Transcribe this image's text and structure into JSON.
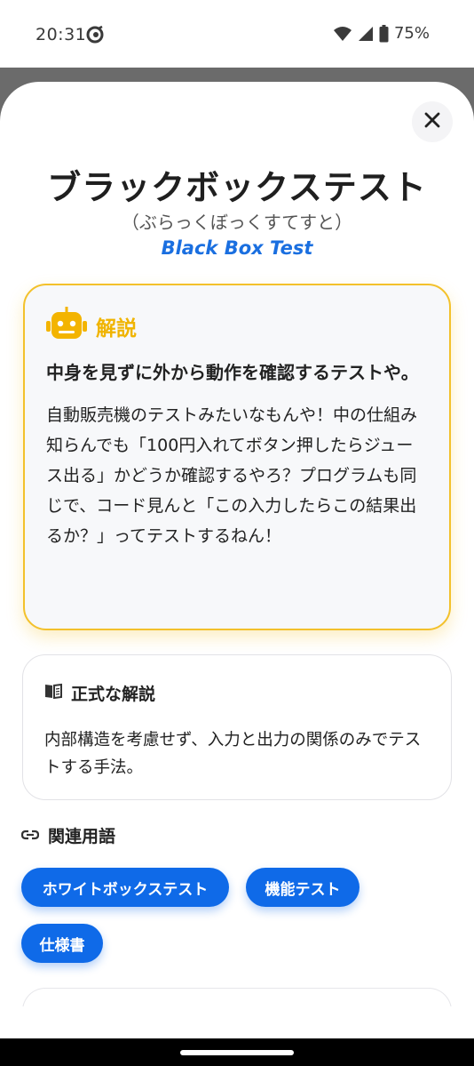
{
  "status_bar": {
    "time": "20:31",
    "battery": "75%",
    "icons": [
      "app-icon",
      "wifi-icon",
      "signal-icon",
      "battery-icon"
    ]
  },
  "sheet": {
    "close_icon": "close-icon",
    "title": "ブラックボックステスト",
    "reading": "（ぶらっくぼっくすてすと）",
    "english": "Black Box Test"
  },
  "robot_card": {
    "icon": "robot-icon",
    "title": "解説",
    "summary": "中身を見ずに外から動作を確認するテストや。",
    "body": "自動販売機のテストみたいなもんや！中の仕組み知らんでも「100円入れてボタン押したらジュース出る」かどうか確認するやろ？プログラムも同じで、コード見んと「この入力したらこの結果出るか？」ってテストするねん！"
  },
  "formal_card": {
    "icon": "book-icon",
    "title": "正式な解説",
    "body": "内部構造を考慮せず、入力と出力の関係のみでテストする手法。"
  },
  "related": {
    "icon": "link-icon",
    "title": "関連用語",
    "terms": [
      "ホワイトボックステスト",
      "機能テスト",
      "仕様書"
    ]
  },
  "colors": {
    "accent_blue": "#0f6ae8",
    "robot_yellow": "#f3c12b",
    "english_blue": "#1a6fe0"
  }
}
